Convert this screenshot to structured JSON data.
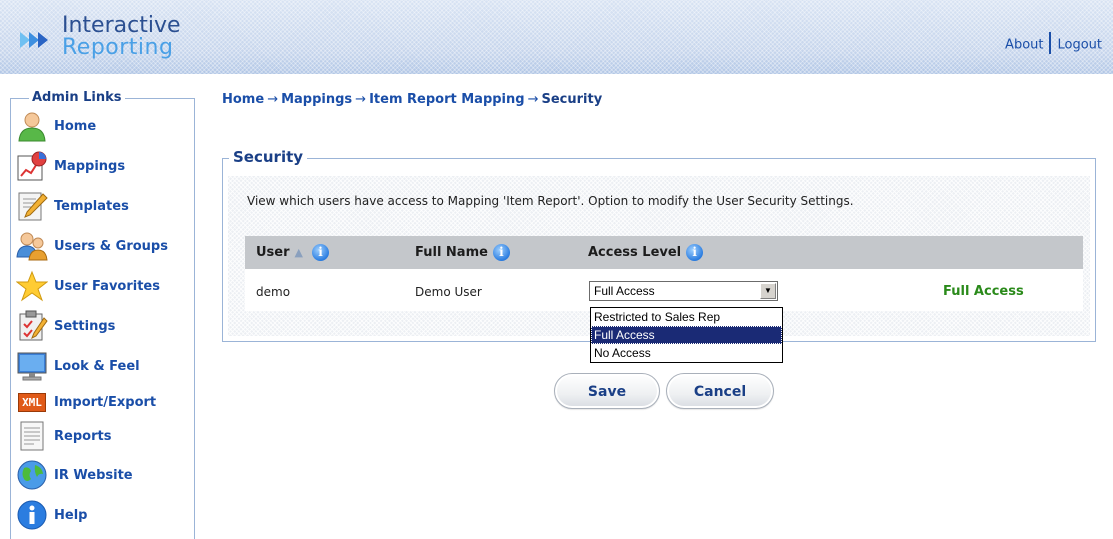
{
  "header": {
    "logo_line1": "Interactive",
    "logo_line2": "Reporting",
    "about_label": "About",
    "logout_label": "Logout"
  },
  "sidebar": {
    "title": "Admin Links",
    "items": [
      {
        "label": "Home",
        "icon": "user-home-icon"
      },
      {
        "label": "Mappings",
        "icon": "mappings-chart-icon"
      },
      {
        "label": "Templates",
        "icon": "template-pencil-icon"
      },
      {
        "label": "Users & Groups",
        "icon": "users-groups-icon"
      },
      {
        "label": "User Favorites",
        "icon": "star-icon"
      },
      {
        "label": "Settings",
        "icon": "settings-clipboard-icon"
      },
      {
        "label": "Look & Feel",
        "icon": "monitor-icon"
      },
      {
        "label": "Import/Export",
        "icon": "xml-icon",
        "icon_text": "XML"
      },
      {
        "label": "Reports",
        "icon": "report-document-icon"
      },
      {
        "label": "IR Website",
        "icon": "globe-icon"
      },
      {
        "label": "Help",
        "icon": "info-icon"
      }
    ]
  },
  "breadcrumb": {
    "items": [
      "Home",
      "Mappings",
      "Item Report Mapping"
    ],
    "current": "Security",
    "separator": "→"
  },
  "security": {
    "title": "Security",
    "description": "View which users have access to Mapping 'Item Report'. Option to modify the User Security Settings.",
    "columns": {
      "user": "User",
      "full_name": "Full Name",
      "access_level": "Access Level"
    },
    "row": {
      "user": "demo",
      "full_name": "Demo User",
      "access_select_value": "Full Access",
      "access_label": "Full Access"
    },
    "dropdown_options": [
      "Restricted to Sales Rep",
      "Full Access",
      "No Access"
    ],
    "dropdown_selected": "Full Access"
  },
  "buttons": {
    "save": "Save",
    "cancel": "Cancel"
  },
  "colors": {
    "link_blue": "#1a4ea8",
    "access_green": "#2a8a1a",
    "header_blue": "#c9d7ec",
    "selected_option": "#1a2a75"
  }
}
